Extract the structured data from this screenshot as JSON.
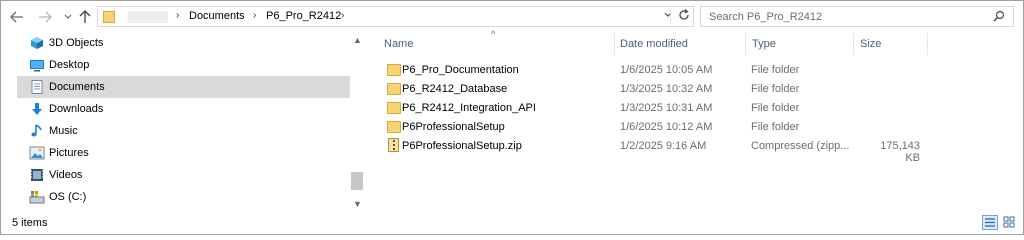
{
  "breadcrumb": {
    "items": [
      "Documents",
      "P6_Pro_R2412"
    ]
  },
  "search": {
    "placeholder": "Search P6_Pro_R2412"
  },
  "sidebar": {
    "items": [
      {
        "label": "3D Objects",
        "icon": "3d-objects-icon"
      },
      {
        "label": "Desktop",
        "icon": "desktop-icon"
      },
      {
        "label": "Documents",
        "icon": "documents-icon",
        "selected": true
      },
      {
        "label": "Downloads",
        "icon": "downloads-icon"
      },
      {
        "label": "Music",
        "icon": "music-icon"
      },
      {
        "label": "Pictures",
        "icon": "pictures-icon"
      },
      {
        "label": "Videos",
        "icon": "videos-icon"
      },
      {
        "label": "OS (C:)",
        "icon": "drive-icon"
      }
    ]
  },
  "columns": {
    "name": "Name",
    "date": "Date modified",
    "type": "Type",
    "size": "Size"
  },
  "files": [
    {
      "name": "P6_Pro_Documentation",
      "date": "1/6/2025 10:05 AM",
      "type": "File folder",
      "size": "",
      "icon": "folder-icon"
    },
    {
      "name": "P6_R2412_Database",
      "date": "1/3/2025 10:32 AM",
      "type": "File folder",
      "size": "",
      "icon": "folder-icon"
    },
    {
      "name": "P6_R2412_Integration_API",
      "date": "1/3/2025 10:31 AM",
      "type": "File folder",
      "size": "",
      "icon": "folder-icon"
    },
    {
      "name": "P6ProfessionalSetup",
      "date": "1/6/2025 10:12 AM",
      "type": "File folder",
      "size": "",
      "icon": "folder-icon"
    },
    {
      "name": "P6ProfessionalSetup.zip",
      "date": "1/2/2025 9:16 AM",
      "type": "Compressed (zipp...",
      "size": "175,143 KB",
      "icon": "zip-file-icon"
    }
  ],
  "status": {
    "item_count": "5 items"
  },
  "colors": {
    "selected": "#d9d9d9",
    "header_text": "#4c607a",
    "folder": "#f8d376",
    "accent": "#0078d7"
  }
}
